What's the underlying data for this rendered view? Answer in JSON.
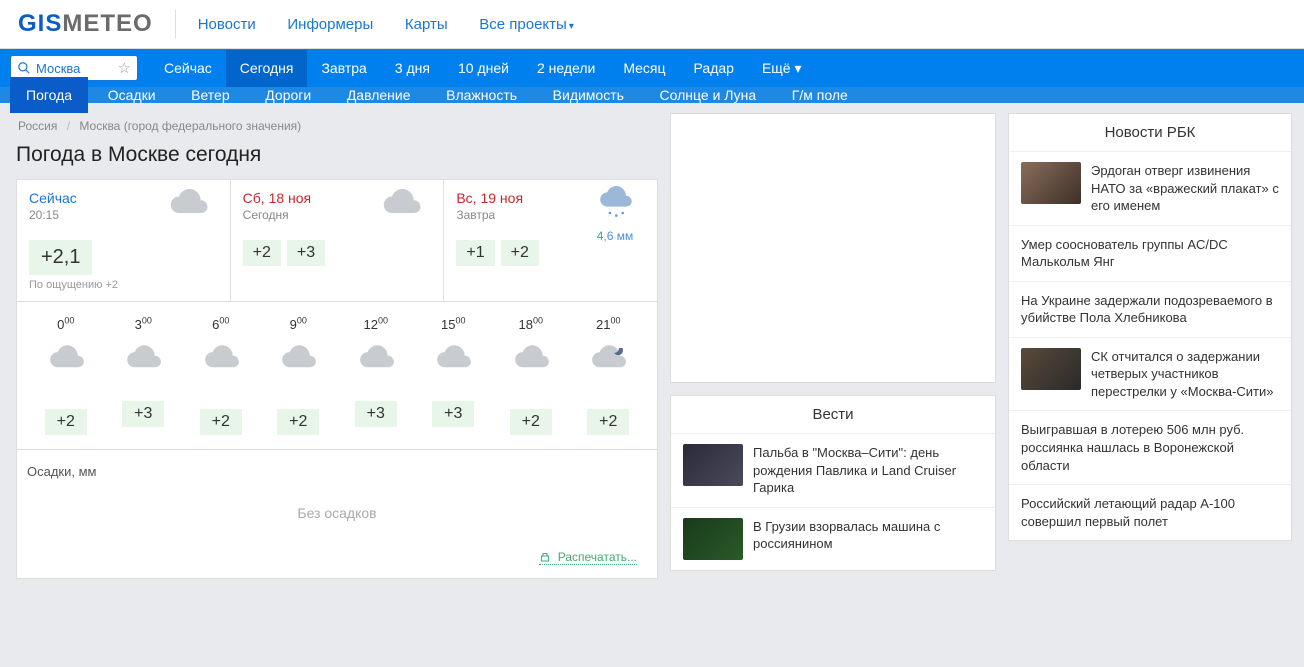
{
  "logo": {
    "part1": "GIS",
    "part2": "METEO"
  },
  "topnav": [
    {
      "label": "Новости"
    },
    {
      "label": "Информеры"
    },
    {
      "label": "Карты"
    },
    {
      "label": "Все проекты",
      "dropdown": true
    }
  ],
  "search": {
    "value": "Москва"
  },
  "tabs1": [
    {
      "label": "Сейчас"
    },
    {
      "label": "Сегодня",
      "active": true
    },
    {
      "label": "Завтра"
    },
    {
      "label": "3 дня"
    },
    {
      "label": "10 дней"
    },
    {
      "label": "2 недели"
    },
    {
      "label": "Месяц"
    },
    {
      "label": "Радар"
    },
    {
      "label": "Ещё",
      "dropdown": true
    }
  ],
  "tabs2": [
    {
      "label": "Погода",
      "active": true
    },
    {
      "label": "Осадки"
    },
    {
      "label": "Ветер"
    },
    {
      "label": "Дороги"
    },
    {
      "label": "Давление"
    },
    {
      "label": "Влажность"
    },
    {
      "label": "Видимость"
    },
    {
      "label": "Солнце и Луна"
    },
    {
      "label": "Г/м поле"
    }
  ],
  "breadcrumb": {
    "items": [
      "Россия",
      "Москва (город федерального значения)"
    ]
  },
  "page_title": "Погода в Москве сегодня",
  "cards": [
    {
      "title": "Сейчас",
      "type": "now",
      "sub": "20:15",
      "temp": "+2,1",
      "feel": "По ощущению +2"
    },
    {
      "title": "Сб, 18 ноя",
      "type": "date",
      "sub": "Сегодня",
      "t1": "+2",
      "t2": "+3"
    },
    {
      "title": "Вс, 19 ноя",
      "type": "date",
      "sub": "Завтра",
      "t1": "+1",
      "t2": "+2",
      "precip": "4,6 мм"
    }
  ],
  "hourly": {
    "times": [
      {
        "h": "0",
        "m": "00"
      },
      {
        "h": "3",
        "m": "00"
      },
      {
        "h": "6",
        "m": "00"
      },
      {
        "h": "9",
        "m": "00"
      },
      {
        "h": "12",
        "m": "00"
      },
      {
        "h": "15",
        "m": "00"
      },
      {
        "h": "18",
        "m": "00"
      },
      {
        "h": "21",
        "m": "00"
      }
    ],
    "temps": [
      "+2",
      "+3",
      "+2",
      "+2",
      "+3",
      "+3",
      "+2",
      "+2"
    ]
  },
  "precip": {
    "title": "Осадки, мм",
    "text": "Без осадков"
  },
  "print_label": "Распечатать...",
  "news_vesti": {
    "title": "Вести",
    "items": [
      {
        "text": "Пальба в \"Москва–Сити\": день рождения Павлика и Land Cruiser Гарика",
        "thumb": "t2"
      },
      {
        "text": "В Грузии взорвалась машина с россиянином",
        "thumb": "t3"
      }
    ]
  },
  "news_rbc": {
    "title": "Новости РБК",
    "items": [
      {
        "text": "Эрдоган отверг извинения НАТО за «вражеский плакат» с его именем",
        "thumb": "t1"
      },
      {
        "text": "Умер сооснователь группы AC/DC Малькольм Янг",
        "noimg": true
      },
      {
        "text": "На Украине задержали подозреваемого в убийстве Пола Хлебникова",
        "noimg": true
      },
      {
        "text": "СК отчитался о задержании четверых участников перестрелки у «Москва-Сити»",
        "thumb": "t4"
      },
      {
        "text": "Выигравшая в лотерею 506 млн руб. россиянка нашлась в Воронежской области",
        "noimg": true
      },
      {
        "text": "Российский летающий радар А-100 совершил первый полет",
        "noimg": true
      }
    ]
  }
}
